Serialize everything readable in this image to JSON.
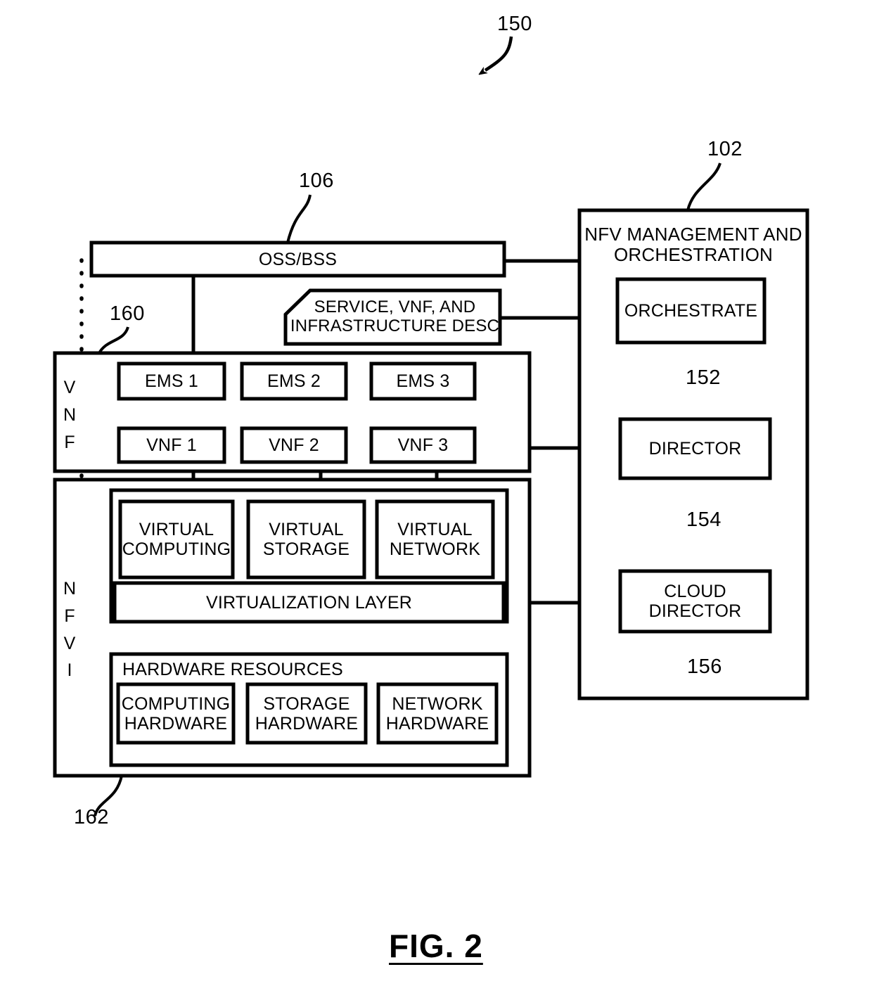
{
  "figure": {
    "caption": "FIG. 2",
    "main_ref": "150"
  },
  "reference_numbers": {
    "system": "150",
    "nfv_mano": "102",
    "oss_bss": "106",
    "vnf_layer": "160",
    "nfvi_layer": "162",
    "orchestrate_link": "152",
    "director_link": "154",
    "cloud_director_link": "156"
  },
  "left_column": {
    "oss_bss": {
      "label": "OSS/BSS"
    },
    "descriptor": {
      "label": "SERVICE, VNF, AND\nINFRASTRUCTURE DESC"
    },
    "vnf_section": {
      "side_label": "V\nN\nF",
      "ems_boxes": [
        {
          "label": "EMS 1"
        },
        {
          "label": "EMS 2"
        },
        {
          "label": "EMS 3"
        }
      ],
      "vnf_boxes": [
        {
          "label": "VNF 1"
        },
        {
          "label": "VNF 2"
        },
        {
          "label": "VNF 3"
        }
      ]
    },
    "nfvi_section": {
      "side_label": "N\nF\nV\nI",
      "virtual_resources": [
        {
          "label": "VIRTUAL\nCOMPUTING"
        },
        {
          "label": "VIRTUAL\nSTORAGE"
        },
        {
          "label": "VIRTUAL\nNETWORK"
        }
      ],
      "virtualization_layer": {
        "label": "VIRTUALIZATION LAYER"
      },
      "hardware_resources": {
        "title": "HARDWARE RESOURCES",
        "items": [
          {
            "label": "COMPUTING\nHARDWARE"
          },
          {
            "label": "STORAGE\nHARDWARE"
          },
          {
            "label": "NETWORK\nHARDWARE"
          }
        ]
      }
    }
  },
  "right_column": {
    "mano": {
      "title": "NFV MANAGEMENT AND\nORCHESTRATION",
      "blocks": [
        {
          "label": "ORCHESTRATE"
        },
        {
          "label": "DIRECTOR"
        },
        {
          "label": "CLOUD\nDIRECTOR"
        }
      ]
    }
  },
  "colors": {
    "stroke": "#000000",
    "fill": "#ffffff"
  }
}
